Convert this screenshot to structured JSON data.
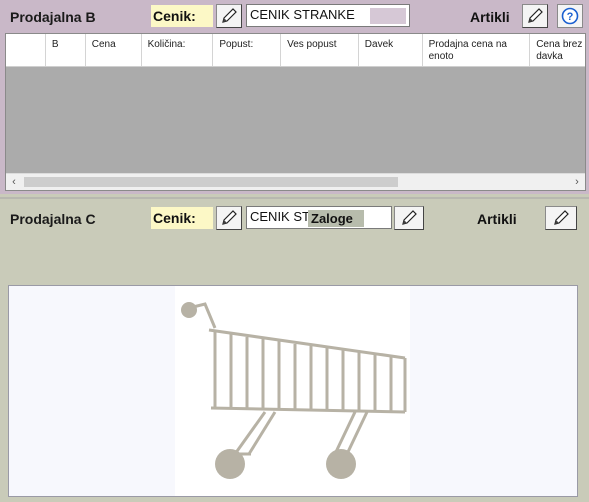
{
  "panel_b": {
    "title": "Prodajalna B",
    "cenik_label": "Cenik:",
    "cenik_value": "CENIK STRANKE",
    "artikli_label": "Artikli",
    "columns": [
      "",
      "B",
      "Cena",
      "Količina:",
      "Popust:",
      "Ves popust",
      "Davek",
      "Prodajna cena na enoto",
      "Cena brez davka"
    ]
  },
  "panel_c": {
    "title": "Prodajalna C",
    "cenik_label": "Cenik:",
    "cenik_value": "CENIK ST",
    "overlay_label": "Zaloge",
    "artikli_label": "Artikli"
  },
  "icons": {
    "edit": "pencil-icon",
    "help": "question-circle-icon",
    "cart": "shopping-cart-icon",
    "scroll_left": "‹",
    "scroll_right": "›"
  },
  "colors": {
    "panel_b_bg": "#c9b8c8",
    "panel_c_bg": "#c9cbb9",
    "cenik_highlight": "#fcf8c6",
    "help_blue": "#1a5fd0"
  }
}
